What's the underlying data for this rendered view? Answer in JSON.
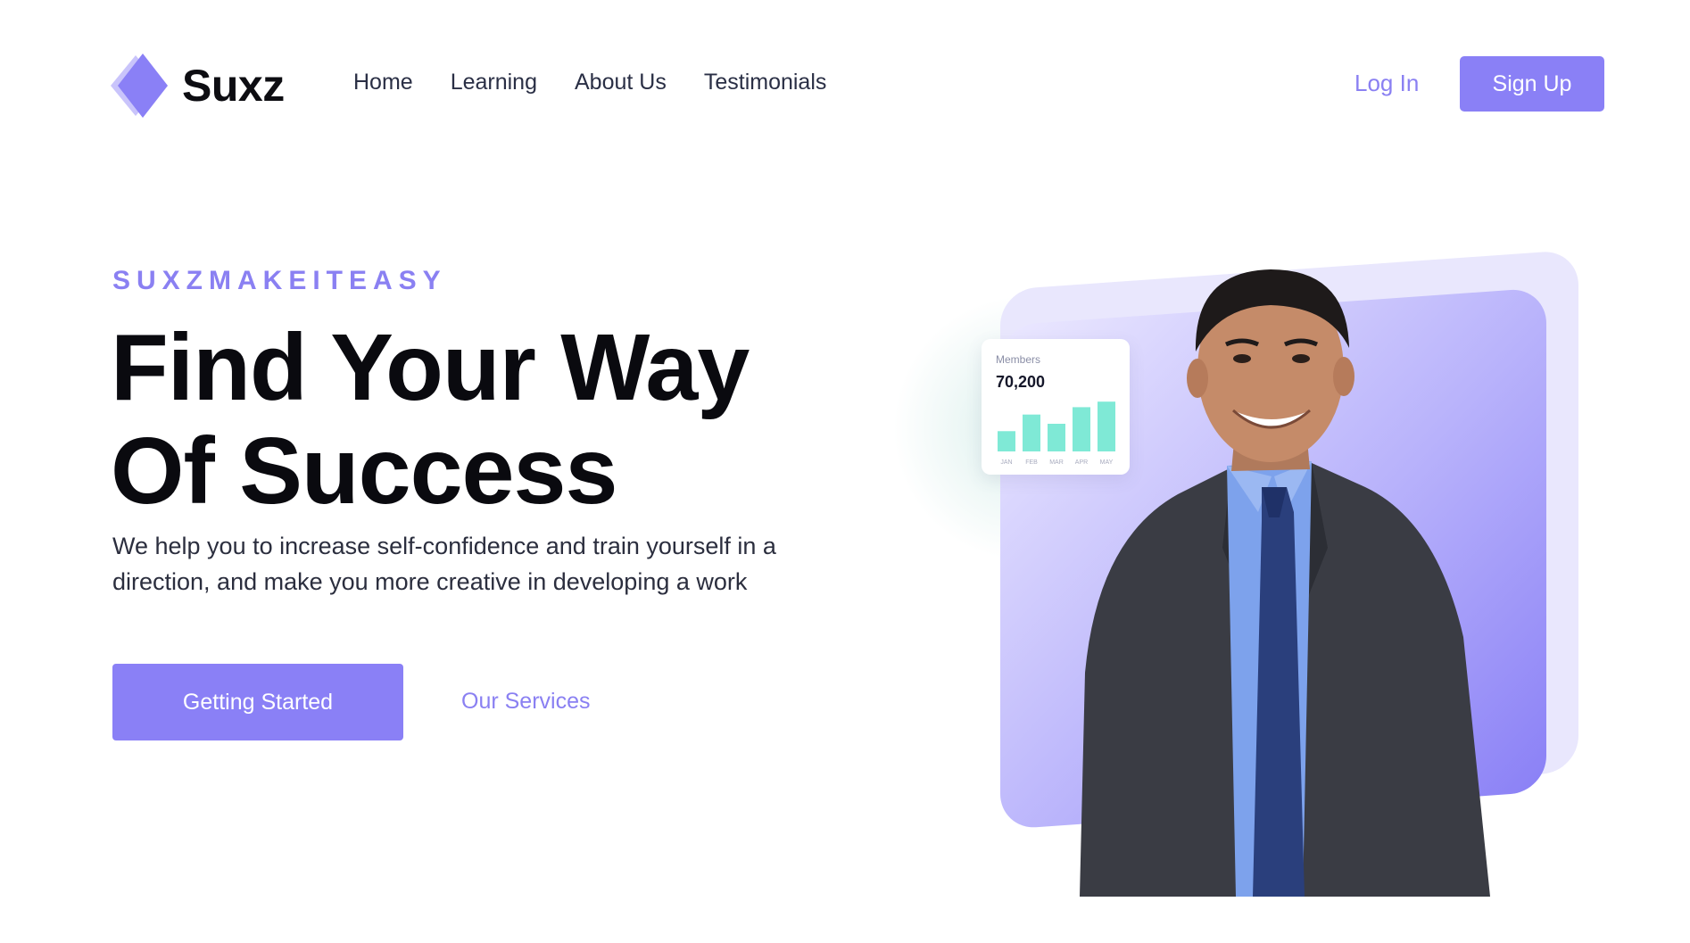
{
  "brand": {
    "name": "Suxz",
    "accent": "#8a80f6"
  },
  "nav": {
    "items": [
      {
        "label": "Home"
      },
      {
        "label": "Learning"
      },
      {
        "label": "About Us"
      },
      {
        "label": "Testimonials"
      }
    ],
    "login_label": "Log In",
    "signup_label": "Sign Up"
  },
  "hero": {
    "eyebrow": "SUXZMAKEITEASY",
    "title_line1": "Find Your Way",
    "title_line2": "Of Success",
    "description": "We help you to increase self-confidence and train yourself in a direction, and make you more creative in developing a work",
    "primary_cta": "Getting Started",
    "secondary_cta": "Our Services"
  },
  "stats_card": {
    "label": "Members",
    "value": "70,200",
    "bar_color": "#7fe9d6",
    "chart_data": {
      "type": "bar",
      "categories": [
        "JAN",
        "FEB",
        "MAR",
        "APR",
        "MAY"
      ],
      "values": [
        22,
        40,
        30,
        48,
        54
      ],
      "ylim": [
        0,
        60
      ]
    }
  },
  "image": {
    "subject": "smiling-businessman"
  }
}
